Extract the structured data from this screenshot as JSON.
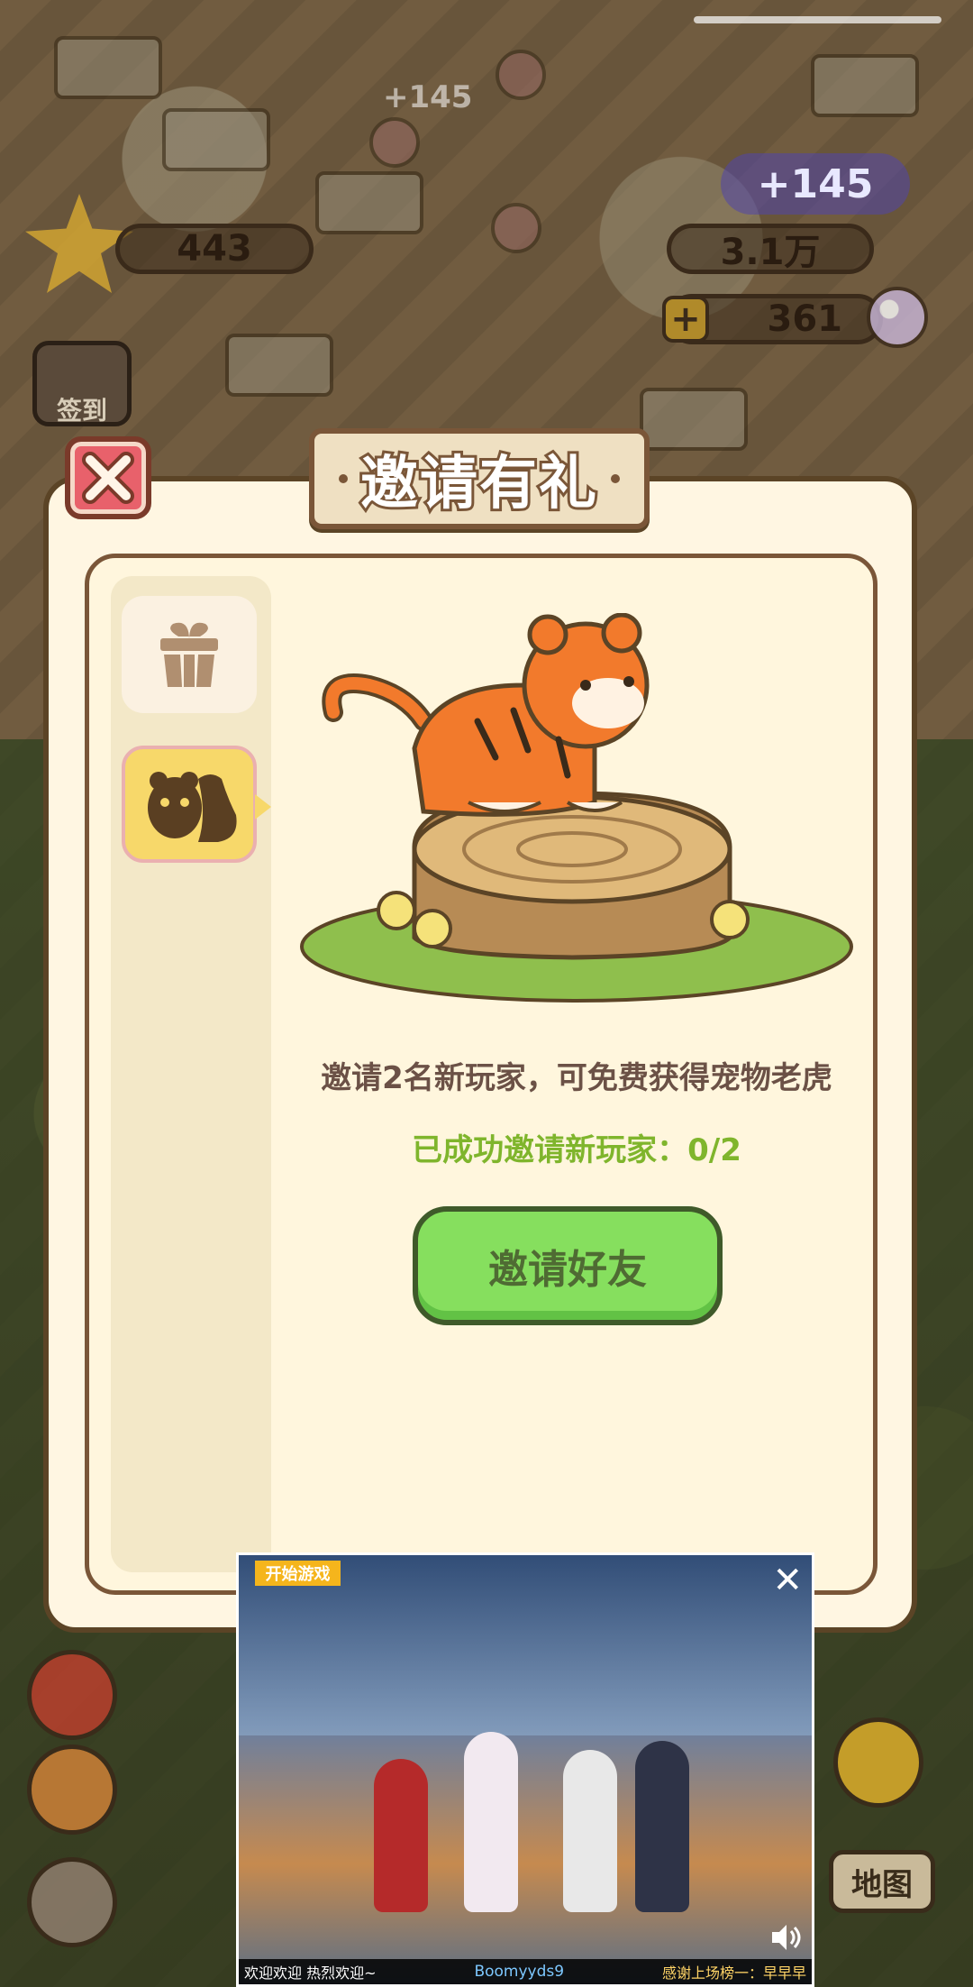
{
  "hud": {
    "star_count": "443",
    "coins": "3.1万",
    "gems": "361",
    "plus_reward": "+145",
    "float_reward": "+145",
    "checkin_label": "签到",
    "map_label": "地图"
  },
  "modal": {
    "title": "邀请有礼",
    "tabs": [
      {
        "name": "gift",
        "icon": "gift-box-icon"
      },
      {
        "name": "pets",
        "icon": "pet-silhouette-icon"
      }
    ],
    "description": "邀请2名新玩家，可免费获得宠物老虎",
    "progress_text": "已成功邀请新玩家：0/2",
    "invite_button": "邀请好友"
  },
  "video_overlay": {
    "start_game": "开始游戏",
    "marquee_left": "欢迎欢迎  热烈欢迎~",
    "marquee_center": "Boomyyds9",
    "marquee_right": "感谢上场榜一：早早早"
  },
  "colors": {
    "modal_bg": "#fff6e2",
    "modal_border": "#5b4426",
    "close_red": "#e8616b",
    "button_green": "#86df5e",
    "progress_green": "#7fb52c",
    "text_brown": "#6b5146",
    "tab_active": "#f7d86a"
  }
}
